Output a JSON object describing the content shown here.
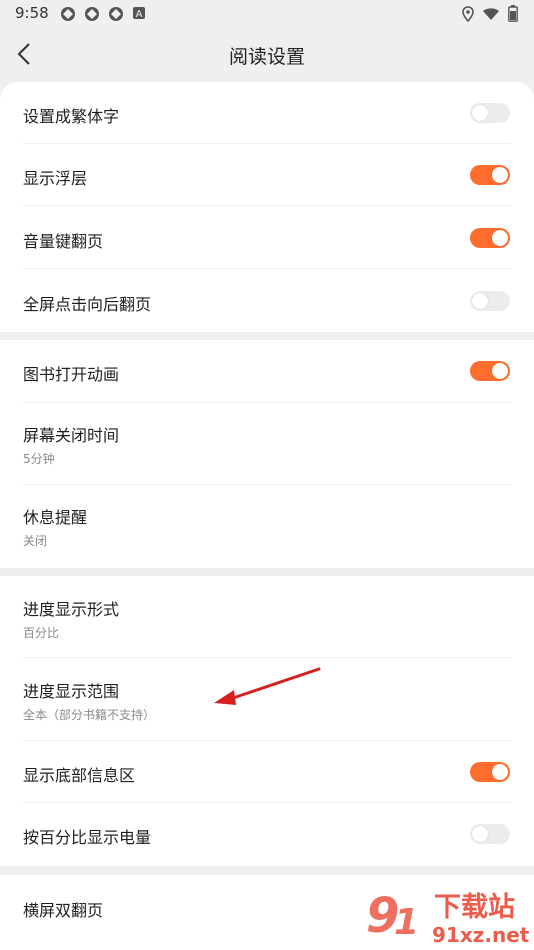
{
  "status": {
    "time": "9:58",
    "notif_icons": [
      "app-notification-icon",
      "app-notification-icon",
      "app-notification-icon",
      "a-letter-icon"
    ],
    "right_icons": [
      "location-icon",
      "wifi-icon",
      "battery-icon"
    ]
  },
  "header": {
    "title": "阅读设置"
  },
  "section1": {
    "rows": [
      {
        "label": "设置成繁体字",
        "toggle": false
      },
      {
        "label": "显示浮层",
        "toggle": true
      },
      {
        "label": "音量键翻页",
        "toggle": true
      },
      {
        "label": "全屏点击向后翻页",
        "toggle": false
      }
    ]
  },
  "section2": {
    "book_anim": {
      "label": "图书打开动画",
      "toggle": true
    },
    "screen_off": {
      "label": "屏幕关闭时间",
      "value": "5分钟"
    },
    "rest_reminder": {
      "label": "休息提醒",
      "value": "关闭"
    }
  },
  "section3": {
    "progress_format": {
      "label": "进度显示形式",
      "value": "百分比"
    },
    "progress_range": {
      "label": "进度显示范围",
      "value": "全本（部分书籍不支持）"
    },
    "bottom_info": {
      "label": "显示底部信息区",
      "toggle": true
    },
    "battery_percent": {
      "label": "按百分比显示电量",
      "toggle": false
    }
  },
  "section4": {
    "landscape": {
      "label": "横屏双翻页"
    }
  },
  "watermark": {
    "text1": "下载站",
    "text2": "91xz.net"
  },
  "colors": {
    "accent": "#ff6d2e",
    "background": "#efefef",
    "card": "#ffffff",
    "arrow": "#d62020"
  }
}
